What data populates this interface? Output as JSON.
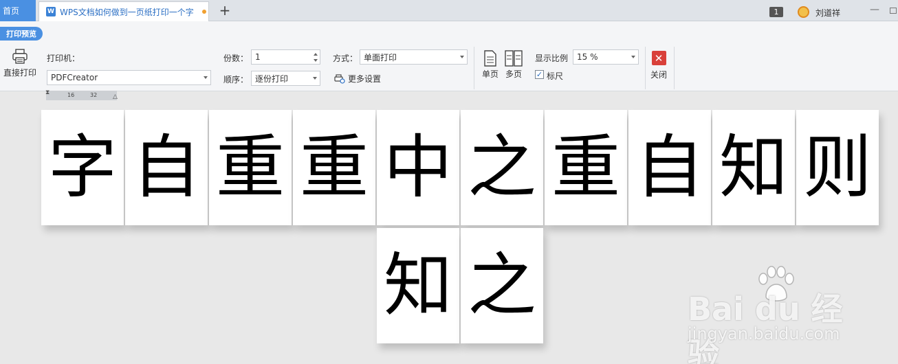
{
  "tabs": {
    "home": "首页",
    "doc_title": "WPS文档如何做到一页纸打印一个字",
    "doc_icon_letter": "W",
    "add": "+"
  },
  "window": {
    "badge": "1",
    "user_name": "刘道祥",
    "minimize": "—"
  },
  "toolbar": {
    "mode_badge": "打印预览",
    "direct_print": "直接打印",
    "printer_label": "打印机：",
    "printer_value": "PDFCreator",
    "copies_label": "份数：",
    "copies_value": "1",
    "order_label": "顺序：",
    "order_value": "逐份打印",
    "method_label": "方式：",
    "method_value": "单面打印",
    "more_settings": "更多设置",
    "single_page": "单页",
    "multi_page": "多页",
    "zoom_label": "显示比例",
    "zoom_value": "15 %",
    "ruler_label": "标尺",
    "ruler_checked": true,
    "close": "关闭"
  },
  "ruler": {
    "tick1": "16",
    "tick2": "32"
  },
  "pages": {
    "row1": [
      "字",
      "自",
      "重",
      "重",
      "中",
      "之",
      "重",
      "自",
      "知",
      "则"
    ],
    "row2": [
      "知",
      "之"
    ]
  },
  "watermark": {
    "brand": "Bai du 经验",
    "url": "jingyan.baidu.com"
  },
  "colors": {
    "accent": "#4a90e2",
    "close_red": "#d9403a",
    "background": "#e8e8e8"
  }
}
